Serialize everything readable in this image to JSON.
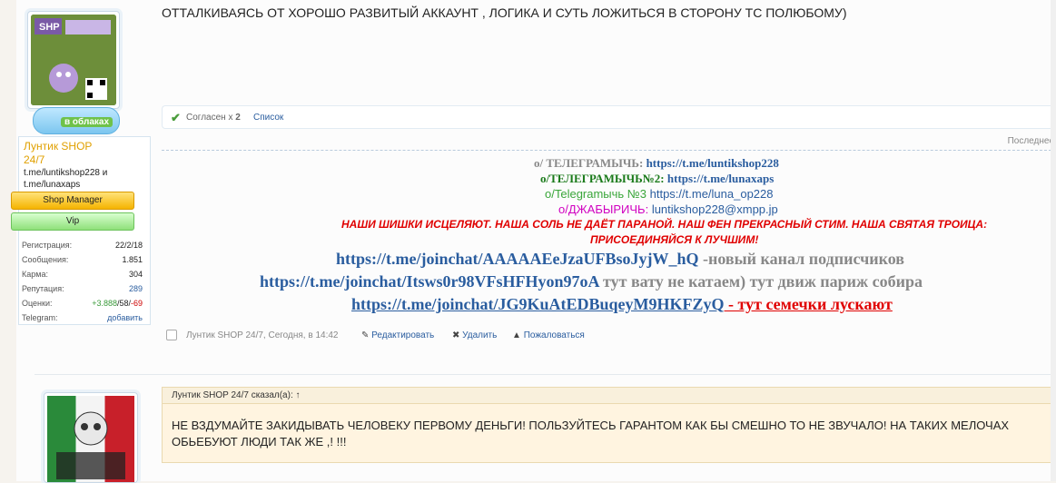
{
  "post": {
    "header_text": "ОТТАЛКИВАЯСЬ ОТ ХОРОШО РАЗВИТЫЙ АККАУНТ , ЛОГИКА И СУТЬ ЛОЖИТЬСЯ В СТОРОНУ ТС ПОЛЮБОМУ)",
    "likes_label": "Согласен x",
    "likes_count": "2",
    "likes_list": "Список",
    "last_edit": "Последнее"
  },
  "user": {
    "name": "Лунтик SHOP 24/7",
    "links": "t.me/luntikshop228 и t.me/lunaxaps",
    "badge_text": "в облаках",
    "role1": "Shop Manager",
    "role2": "Vip",
    "stats": [
      {
        "label": "Регистрация:",
        "value": "22/2/18"
      },
      {
        "label": "Сообщения:",
        "value": "1.851"
      },
      {
        "label": "Карма:",
        "value": "304"
      },
      {
        "label": "Репутация:",
        "value": "289"
      }
    ],
    "rating_label": "Оценки:",
    "rating_pos": "+3.888",
    "rating_mid": "/58/",
    "rating_neg": "-69",
    "telegram_label": "Telegram:",
    "telegram_action": "добавить"
  },
  "signature": {
    "l1_label": "о/ ТЕЛЕГРАМЫЧЬ:",
    "l1_link": "https://t.me/luntikshop228",
    "l2_label": "о/ТЕЛЕГРАМЫЧЬ№2:",
    "l2_link": "https://t.me/lunaxaps",
    "l3_label": "о/Telegramычь №3",
    "l3_link": "https://t.me/luna_op228",
    "l4_label": "о/ДЖАБЫРИЧЬ:",
    "l4_link": "luntikshop228@xmpp.jp",
    "red_line1": "НАШИ ШИШКИ ИСЦЕЛЯЮТ. НАША СОЛЬ НЕ ДАЁТ ПАРАНОЙ. НАШ ФЕН ПРЕКРАСНЫЙ СТИМ. НАША СВЯТАЯ ТРОИЦА:",
    "red_line2": "ПРИСОЕДИНЯЙСЯ К ЛУЧШИМ!",
    "j1_link": "https://t.me/joinchat/AAAAAEeJzaUFBsoJyjW_hQ",
    "j1_text": "-новый канал подписчиков",
    "j2_link": "https://t.me/joinchat/Itsws0r98VFsHFHyon97oA",
    "j2_text": "тут вату не катаем) тут движ париж собира",
    "j3_link": "https://t.me/joinchat/JG9KuAtEDBuqeyM9HKFZyQ",
    "j3_text": " - тут семечки лускают "
  },
  "footer": {
    "meta": "Лунтик SHOP 24/7, Сегодня, в 14:42",
    "edit": "Редактировать",
    "delete": "Удалить",
    "report": "Пожаловаться"
  },
  "quote": {
    "head": "Лунтик SHOP 24/7 сказал(а): ↑",
    "text": "НЕ ВЗДУМАЙТЕ ЗАКИДЫВАТЬ ЧЕЛОВЕКУ ПЕРВОМУ ДЕНЬГИ! ПОЛЬЗУЙТЕСЬ ГАРАНТОМ КАК БЫ СМЕШНО ТО НЕ ЗВУЧАЛО! НА ТАКИХ МЕЛОЧАХ ОБЬЕБУЮТ ЛЮДИ ТАК ЖЕ ,! !!!"
  },
  "colors": {
    "link": "#2a5d9f",
    "red": "#e00000",
    "username": "#e0a000"
  }
}
